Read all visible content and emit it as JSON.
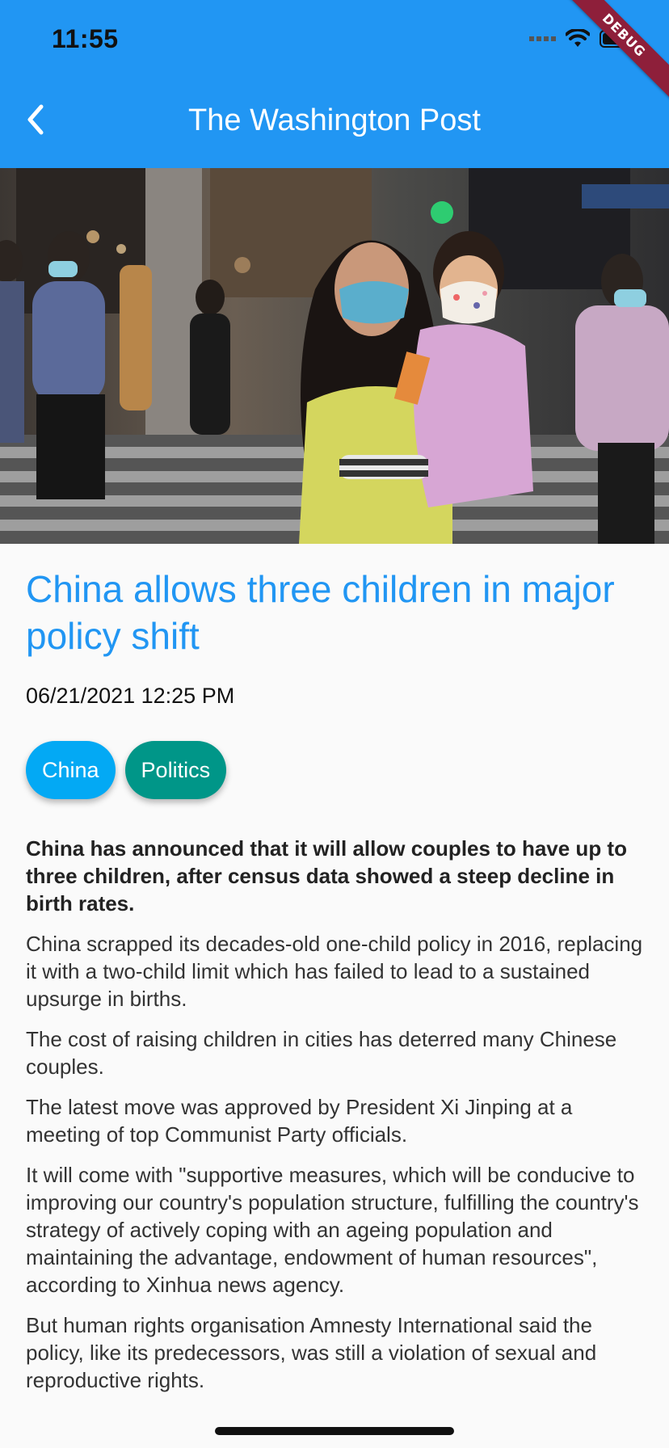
{
  "status_bar": {
    "time": "11:55",
    "debug_label": "DEBUG"
  },
  "app_bar": {
    "title": "The Washington Post",
    "back_icon": "chevron-left-icon",
    "color": "#2196f3"
  },
  "article": {
    "headline": "China allows three children in major policy shift",
    "date": "06/21/2021 12:25 PM",
    "tags": [
      {
        "label": "China",
        "color": "#03a9f4"
      },
      {
        "label": "Politics",
        "color": "#009688"
      }
    ],
    "lead": "China has announced that it will allow couples to have up to three children, after census data showed a steep decline in birth rates.",
    "paragraphs": [
      "China scrapped its decades-old one-child policy in 2016, replacing it with a two-child limit which has failed to lead to a sustained upsurge in births.",
      "The cost of raising children in cities has deterred many Chinese couples.",
      "The latest move was approved by President Xi Jinping at a meeting of top Communist Party officials.",
      "It will come with \"supportive measures, which will be conducive to improving our country's population structure, fulfilling the country's strategy of actively coping with an ageing population and maintaining the advantage, endowment of human resources\", according to Xinhua news agency.",
      "But human rights organisation Amnesty International said the policy, like its predecessors, was still a violation of sexual and reproductive rights."
    ]
  }
}
